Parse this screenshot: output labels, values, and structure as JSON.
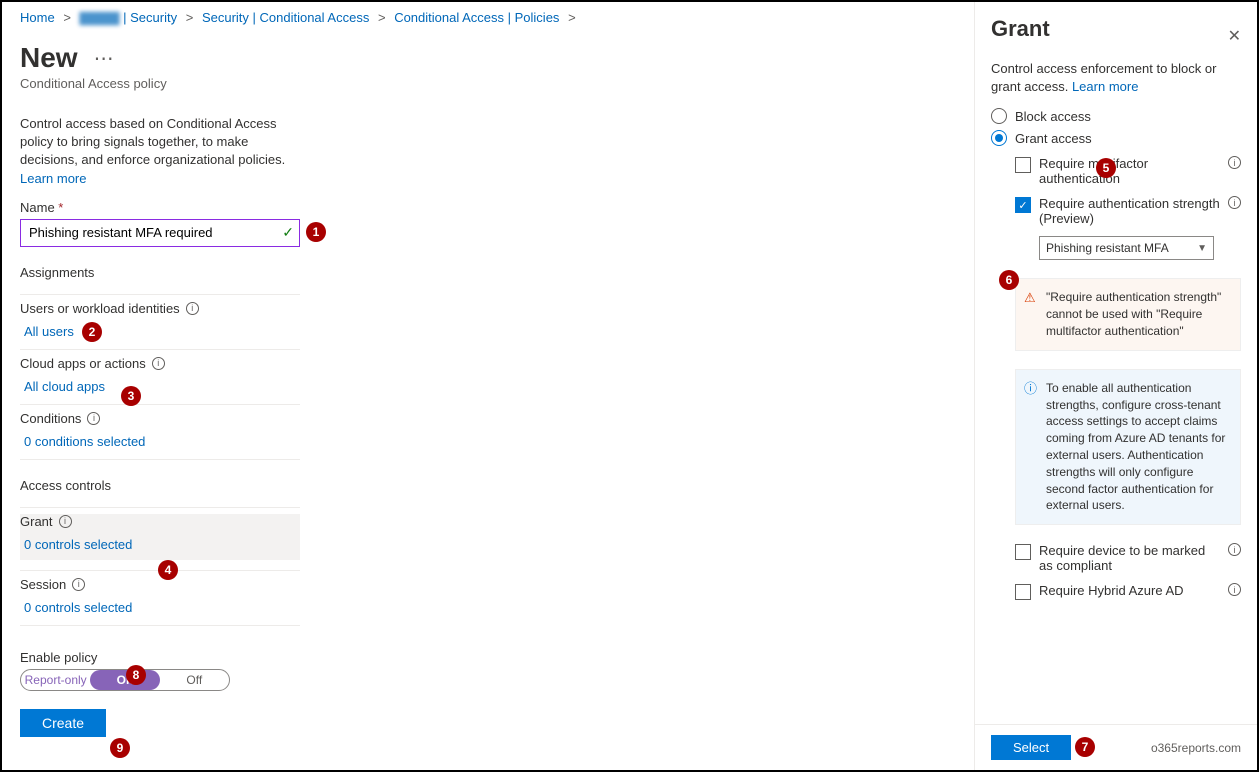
{
  "breadcrumbs": {
    "home": "Home",
    "obscured": "▇▇▇▇",
    "sec1": " | Security",
    "sec2": "Security | Conditional Access",
    "sec3": "Conditional Access | Policies"
  },
  "title": "New",
  "subtitle": "Conditional Access policy",
  "intro": "Control access based on Conditional Access policy to bring signals together, to make decisions, and enforce organizational policies.",
  "learn_more": "Learn more",
  "name_label": "Name",
  "name_value": "Phishing resistant MFA required",
  "assignments_label": "Assignments",
  "users": {
    "label": "Users or workload identities",
    "value": "All users"
  },
  "apps": {
    "label": "Cloud apps or actions",
    "value": "All cloud apps"
  },
  "conds": {
    "label": "Conditions",
    "value": "0 conditions selected"
  },
  "access_controls_label": "Access controls",
  "grant": {
    "label": "Grant",
    "value": "0 controls selected"
  },
  "session": {
    "label": "Session",
    "value": "0 controls selected"
  },
  "enable_label": "Enable policy",
  "enable_opts": {
    "report": "Report-only",
    "on": "On",
    "off": "Off"
  },
  "create": "Create",
  "panel": {
    "title": "Grant",
    "intro": "Control access enforcement to block or grant access.",
    "radio_block": "Block access",
    "radio_grant": "Grant access",
    "opt_mfa": "Require multifactor authentication",
    "opt_strength": "Require authentication strength (Preview)",
    "strength_value": "Phishing resistant MFA",
    "warn": "\"Require authentication strength\" cannot be used with \"Require multifactor authentication\"",
    "info": "To enable all authentication strengths, configure cross-tenant access settings to accept claims coming from Azure AD tenants for external users. Authentication strengths will only configure second factor authentication for external users.",
    "opt_compliant": "Require device to be marked as compliant",
    "opt_hybrid": "Require Hybrid Azure AD",
    "select": "Select",
    "brand": "o365reports.com"
  },
  "badges": {
    "b1": "1",
    "b2": "2",
    "b3": "3",
    "b4": "4",
    "b5": "5",
    "b6": "6",
    "b7": "7",
    "b8": "8",
    "b9": "9"
  }
}
